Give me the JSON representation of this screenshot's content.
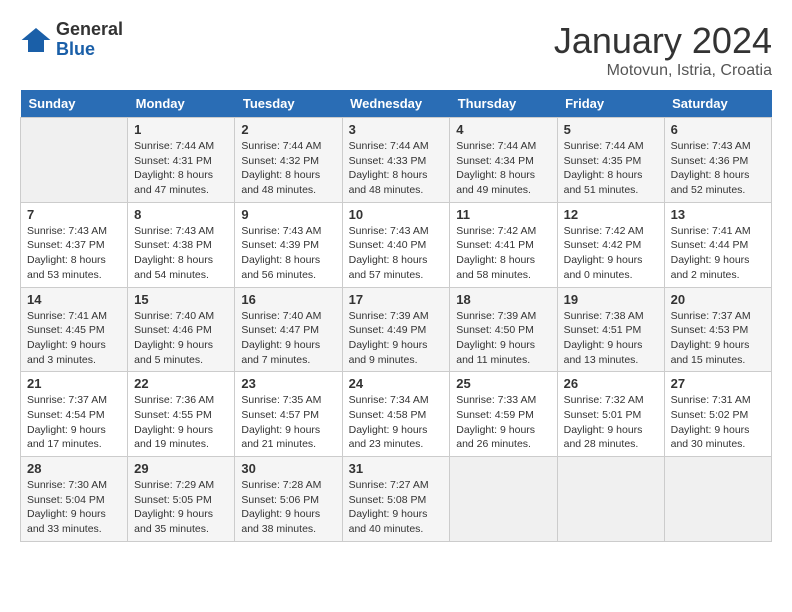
{
  "logo": {
    "general": "General",
    "blue": "Blue"
  },
  "header": {
    "title": "January 2024",
    "subtitle": "Motovun, Istria, Croatia"
  },
  "weekdays": [
    "Sunday",
    "Monday",
    "Tuesday",
    "Wednesday",
    "Thursday",
    "Friday",
    "Saturday"
  ],
  "weeks": [
    {
      "days": [
        {
          "number": "",
          "empty": true
        },
        {
          "number": "1",
          "sunrise": "7:44 AM",
          "sunset": "4:31 PM",
          "daylight": "8 hours and 47 minutes."
        },
        {
          "number": "2",
          "sunrise": "7:44 AM",
          "sunset": "4:32 PM",
          "daylight": "8 hours and 48 minutes."
        },
        {
          "number": "3",
          "sunrise": "7:44 AM",
          "sunset": "4:33 PM",
          "daylight": "8 hours and 48 minutes."
        },
        {
          "number": "4",
          "sunrise": "7:44 AM",
          "sunset": "4:34 PM",
          "daylight": "8 hours and 49 minutes."
        },
        {
          "number": "5",
          "sunrise": "7:44 AM",
          "sunset": "4:35 PM",
          "daylight": "8 hours and 51 minutes."
        },
        {
          "number": "6",
          "sunrise": "7:43 AM",
          "sunset": "4:36 PM",
          "daylight": "8 hours and 52 minutes."
        }
      ]
    },
    {
      "days": [
        {
          "number": "7",
          "sunrise": "7:43 AM",
          "sunset": "4:37 PM",
          "daylight": "8 hours and 53 minutes."
        },
        {
          "number": "8",
          "sunrise": "7:43 AM",
          "sunset": "4:38 PM",
          "daylight": "8 hours and 54 minutes."
        },
        {
          "number": "9",
          "sunrise": "7:43 AM",
          "sunset": "4:39 PM",
          "daylight": "8 hours and 56 minutes."
        },
        {
          "number": "10",
          "sunrise": "7:43 AM",
          "sunset": "4:40 PM",
          "daylight": "8 hours and 57 minutes."
        },
        {
          "number": "11",
          "sunrise": "7:42 AM",
          "sunset": "4:41 PM",
          "daylight": "8 hours and 58 minutes."
        },
        {
          "number": "12",
          "sunrise": "7:42 AM",
          "sunset": "4:42 PM",
          "daylight": "9 hours and 0 minutes."
        },
        {
          "number": "13",
          "sunrise": "7:41 AM",
          "sunset": "4:44 PM",
          "daylight": "9 hours and 2 minutes."
        }
      ]
    },
    {
      "days": [
        {
          "number": "14",
          "sunrise": "7:41 AM",
          "sunset": "4:45 PM",
          "daylight": "9 hours and 3 minutes."
        },
        {
          "number": "15",
          "sunrise": "7:40 AM",
          "sunset": "4:46 PM",
          "daylight": "9 hours and 5 minutes."
        },
        {
          "number": "16",
          "sunrise": "7:40 AM",
          "sunset": "4:47 PM",
          "daylight": "9 hours and 7 minutes."
        },
        {
          "number": "17",
          "sunrise": "7:39 AM",
          "sunset": "4:49 PM",
          "daylight": "9 hours and 9 minutes."
        },
        {
          "number": "18",
          "sunrise": "7:39 AM",
          "sunset": "4:50 PM",
          "daylight": "9 hours and 11 minutes."
        },
        {
          "number": "19",
          "sunrise": "7:38 AM",
          "sunset": "4:51 PM",
          "daylight": "9 hours and 13 minutes."
        },
        {
          "number": "20",
          "sunrise": "7:37 AM",
          "sunset": "4:53 PM",
          "daylight": "9 hours and 15 minutes."
        }
      ]
    },
    {
      "days": [
        {
          "number": "21",
          "sunrise": "7:37 AM",
          "sunset": "4:54 PM",
          "daylight": "9 hours and 17 minutes."
        },
        {
          "number": "22",
          "sunrise": "7:36 AM",
          "sunset": "4:55 PM",
          "daylight": "9 hours and 19 minutes."
        },
        {
          "number": "23",
          "sunrise": "7:35 AM",
          "sunset": "4:57 PM",
          "daylight": "9 hours and 21 minutes."
        },
        {
          "number": "24",
          "sunrise": "7:34 AM",
          "sunset": "4:58 PM",
          "daylight": "9 hours and 23 minutes."
        },
        {
          "number": "25",
          "sunrise": "7:33 AM",
          "sunset": "4:59 PM",
          "daylight": "9 hours and 26 minutes."
        },
        {
          "number": "26",
          "sunrise": "7:32 AM",
          "sunset": "5:01 PM",
          "daylight": "9 hours and 28 minutes."
        },
        {
          "number": "27",
          "sunrise": "7:31 AM",
          "sunset": "5:02 PM",
          "daylight": "9 hours and 30 minutes."
        }
      ]
    },
    {
      "days": [
        {
          "number": "28",
          "sunrise": "7:30 AM",
          "sunset": "5:04 PM",
          "daylight": "9 hours and 33 minutes."
        },
        {
          "number": "29",
          "sunrise": "7:29 AM",
          "sunset": "5:05 PM",
          "daylight": "9 hours and 35 minutes."
        },
        {
          "number": "30",
          "sunrise": "7:28 AM",
          "sunset": "5:06 PM",
          "daylight": "9 hours and 38 minutes."
        },
        {
          "number": "31",
          "sunrise": "7:27 AM",
          "sunset": "5:08 PM",
          "daylight": "9 hours and 40 minutes."
        },
        {
          "number": "",
          "empty": true
        },
        {
          "number": "",
          "empty": true
        },
        {
          "number": "",
          "empty": true
        }
      ]
    }
  ],
  "labels": {
    "sunrise": "Sunrise:",
    "sunset": "Sunset:",
    "daylight": "Daylight:"
  }
}
